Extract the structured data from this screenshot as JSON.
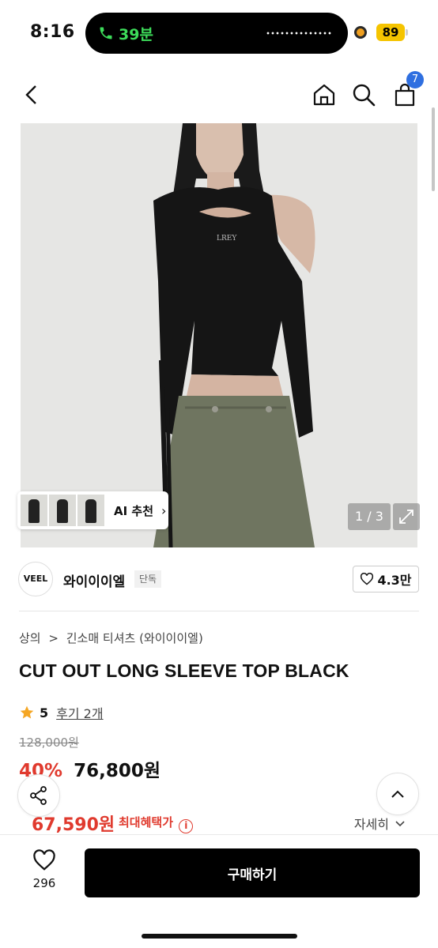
{
  "status_bar": {
    "time": "8:16",
    "call_timer": "39분",
    "battery": "89"
  },
  "nav": {
    "cart_count": "7"
  },
  "gallery": {
    "ai_recommend_label": "AI 추천",
    "page_indicator": "1 / 3",
    "shirt_logo_text": "LREY"
  },
  "brand": {
    "logo_text": "VEEL",
    "name": "와이이이엘",
    "badge": "단독",
    "likes": "4.3만"
  },
  "breadcrumb": {
    "category": "상의",
    "separator": ">",
    "subcategory": "긴소매 티셔츠 (와이이이엘)"
  },
  "product": {
    "title": "CUT OUT LONG SLEEVE TOP BLACK",
    "rating": "5",
    "review_link": "후기 2개",
    "original_price": "128,000원",
    "discount": "40%",
    "sale_price": "76,800원",
    "max_benefit_price": "67,590원",
    "max_benefit_label": "최대혜택가",
    "detail_link": "자세히"
  },
  "bottom_bar": {
    "wish_count": "296",
    "buy_label": "구매하기"
  },
  "colors": {
    "accent_red": "#e03a2e",
    "badge_blue": "#2f6fe0",
    "buy_button": "#000000",
    "call_green": "#3ddc5a",
    "battery_yellow": "#f5c400",
    "star": "#f5a623"
  },
  "icons": [
    "phone-icon",
    "back-icon",
    "home-icon",
    "search-icon",
    "cart-icon",
    "chevron-right-icon",
    "expand-icon",
    "heart-icon",
    "star-icon",
    "share-icon",
    "chevron-up-icon",
    "info-icon",
    "chevron-down-icon"
  ]
}
